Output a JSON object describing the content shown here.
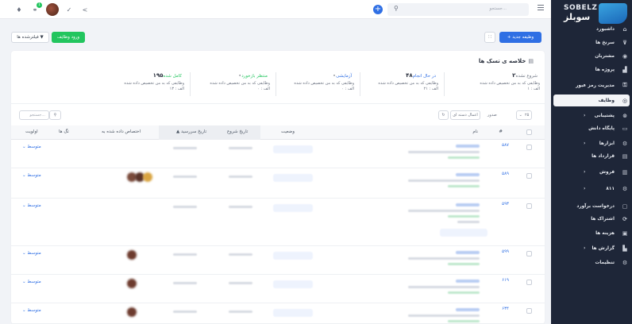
{
  "topbar": {
    "notification_badge": "1",
    "search_placeholder": "جستجو...",
    "icons": [
      "bell-icon",
      "link-icon",
      "check-icon",
      "share-icon",
      "plus-icon",
      "search-icon",
      "menu-icon"
    ]
  },
  "brand": {
    "name_en": "SOBELZ",
    "name_fa": "سوبلز"
  },
  "sidebar": {
    "items": [
      {
        "label": "داشبورد",
        "icon": "home-icon",
        "active": false,
        "expandable": false
      },
      {
        "label": "سرنخ ها",
        "icon": "funnel-icon",
        "active": false,
        "expandable": false
      },
      {
        "label": "مشتریان",
        "icon": "user-icon",
        "active": false,
        "expandable": false
      },
      {
        "label": "پروژه ها",
        "icon": "chart-icon",
        "active": false,
        "expandable": false
      },
      {
        "label": "مدیریت رمز عبور",
        "icon": "key-icon",
        "active": false,
        "expandable": true
      },
      {
        "label": "وظایف",
        "icon": "check-circle-icon",
        "active": true,
        "expandable": false
      },
      {
        "label": "پشتیبانی",
        "icon": "support-icon",
        "active": false,
        "expandable": true
      },
      {
        "label": "پایگاه دانش",
        "icon": "folder-icon",
        "active": false,
        "expandable": false
      },
      {
        "label": "ابزارها",
        "icon": "tools-icon",
        "active": false,
        "expandable": true
      },
      {
        "label": "قرارداد ها",
        "icon": "document-icon",
        "active": false,
        "expandable": false
      },
      {
        "label": "فروش",
        "icon": "invoice-icon",
        "active": false,
        "expandable": true
      },
      {
        "label": "۸۱۱",
        "icon": "gears-icon",
        "active": false,
        "expandable": true
      },
      {
        "label": "درخواست برآورد",
        "icon": "file-icon",
        "active": false,
        "expandable": false
      },
      {
        "label": "اشتراک ها",
        "icon": "refresh-icon",
        "active": false,
        "expandable": false
      },
      {
        "label": "هزینه ها",
        "icon": "receipt-icon",
        "active": false,
        "expandable": false
      },
      {
        "label": "گزارش ها",
        "icon": "report-icon",
        "active": false,
        "expandable": true
      },
      {
        "label": "تنظیمات",
        "icon": "settings-icon",
        "active": false,
        "expandable": false
      }
    ]
  },
  "toolbar": {
    "new_task": "+ وظیفه جدید",
    "import_tasks": "ورود وظایف",
    "filter": "فیلترشده ها"
  },
  "summary": {
    "title": "خلاصه ی تسک ها",
    "stats": [
      {
        "count": "۲",
        "status": "شروع نشده",
        "status_color": "#6b7280",
        "desc_1": "وظایفی که به من تخصیص داده شده",
        "desc_2": "الف : ۱"
      },
      {
        "count": "۴۸",
        "status": "در حال انجام",
        "status_color": "#2f6fe4",
        "desc_1": "وظایفی که به من تخصیص داده شده",
        "desc_2": "الف : ۲۱"
      },
      {
        "count": "۰",
        "status": "آزمایشی",
        "status_color": "#2f6fe4",
        "desc_1": "وظایفی که به من تخصیص داده شده",
        "desc_2": "الف : ۰"
      },
      {
        "count": "۰",
        "status": "منتظر بازخورد",
        "status_color": "#22c55e",
        "desc_1": "وظایفی که به من تخصیص داده شده",
        "desc_2": "الف : ۰"
      },
      {
        "count": "۱۹۵",
        "status": "کامل شده",
        "status_color": "#22c55e",
        "desc_1": "وظایفی که به من تخصیص داده شده",
        "desc_2": "الف : ۱۳"
      }
    ]
  },
  "table_controls": {
    "page_size": "۲۵",
    "export": "صدور",
    "bulk": "اعمال دسته ای",
    "search_placeholder": "جستجو..."
  },
  "table": {
    "headers": {
      "id": "#",
      "name": "نام",
      "status": "وضعیت",
      "start_date": "تاریخ شروع",
      "due_date": "تاریخ سررسید",
      "assigned": "اختصاص داده شده به",
      "tags": "تگ ها",
      "priority": "اولویت"
    },
    "rows": [
      {
        "id": "۵۸۷",
        "priority": "متوسط",
        "assignees": 0
      },
      {
        "id": "۵۸۹",
        "priority": "متوسط",
        "assignees": 3
      },
      {
        "id": "۵۹۳",
        "priority": "متوسط",
        "assignees": 0
      },
      {
        "id": "۵۹۹",
        "priority": "متوسط",
        "assignees": 1
      },
      {
        "id": "۶۱۹",
        "priority": "متوسط",
        "assignees": 1
      },
      {
        "id": "۶۳۴",
        "priority": "متوسط",
        "assignees": 1
      }
    ]
  }
}
